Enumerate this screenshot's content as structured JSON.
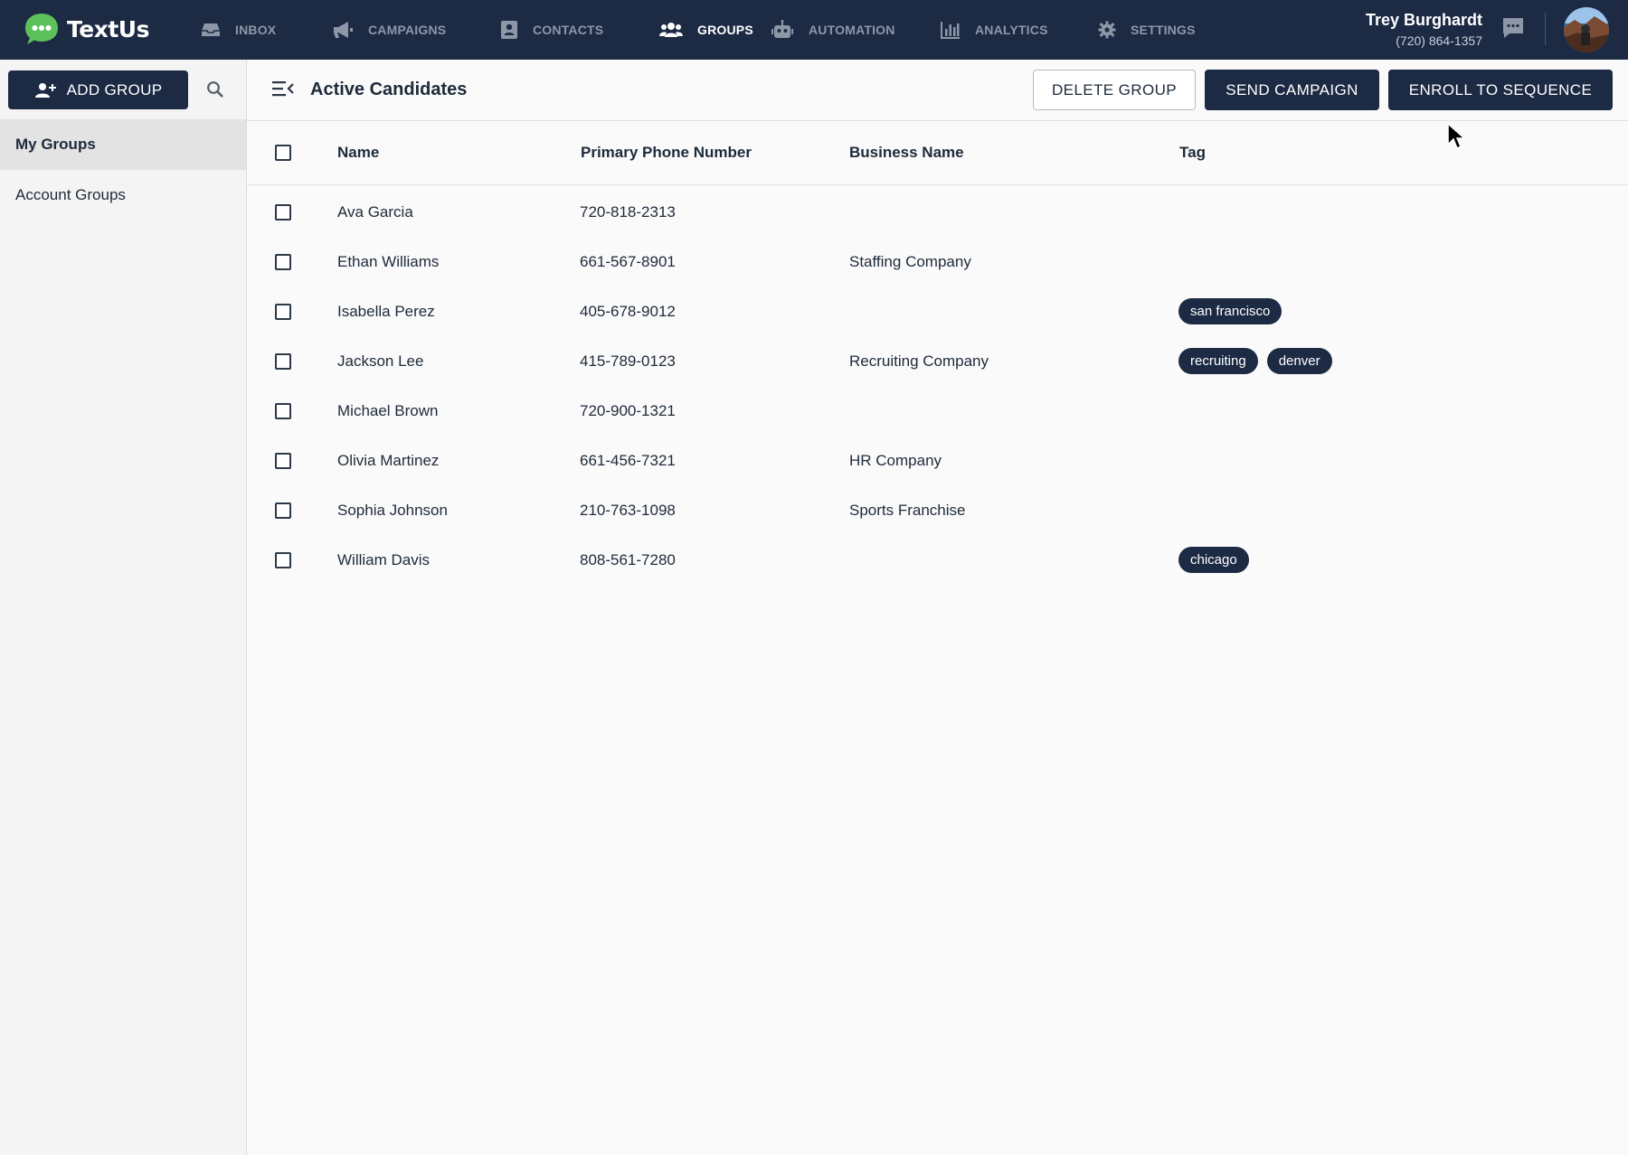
{
  "app": {
    "name": "TextUs"
  },
  "nav": {
    "items": [
      {
        "label": "INBOX",
        "icon": "inbox-icon",
        "active": false
      },
      {
        "label": "CAMPAIGNS",
        "icon": "megaphone-icon",
        "active": false
      },
      {
        "label": "CONTACTS",
        "icon": "contact-book-icon",
        "active": false
      },
      {
        "label": "GROUPS",
        "icon": "users-icon",
        "active": true
      },
      {
        "label": "AUTOMATION",
        "icon": "robot-icon",
        "active": false
      },
      {
        "label": "ANALYTICS",
        "icon": "bar-chart-icon",
        "active": false
      },
      {
        "label": "SETTINGS",
        "icon": "gear-icon",
        "active": false
      }
    ]
  },
  "user": {
    "name": "Trey Burghardt",
    "phone": "(720) 864-1357"
  },
  "sidebar": {
    "add_group_label": "ADD GROUP",
    "items": [
      {
        "label": "My Groups",
        "active": true
      },
      {
        "label": "Account Groups",
        "active": false
      }
    ]
  },
  "header": {
    "title": "Active Candidates",
    "delete_label": "DELETE GROUP",
    "send_label": "SEND CAMPAIGN",
    "enroll_label": "ENROLL TO SEQUENCE"
  },
  "table": {
    "columns": [
      "Name",
      "Primary Phone Number",
      "Business Name",
      "Tag"
    ],
    "rows": [
      {
        "name": "Ava Garcia",
        "phone": "720-818-2313",
        "business": "",
        "tags": []
      },
      {
        "name": "Ethan Williams",
        "phone": "661-567-8901",
        "business": "Staffing Company",
        "tags": []
      },
      {
        "name": "Isabella Perez",
        "phone": "405-678-9012",
        "business": "",
        "tags": [
          "san francisco"
        ]
      },
      {
        "name": "Jackson Lee",
        "phone": "415-789-0123",
        "business": "Recruiting Company",
        "tags": [
          "recruiting",
          "denver"
        ]
      },
      {
        "name": "Michael Brown",
        "phone": "720-900-1321",
        "business": "",
        "tags": []
      },
      {
        "name": "Olivia Martinez",
        "phone": "661-456-7321",
        "business": "HR Company",
        "tags": []
      },
      {
        "name": "Sophia Johnson",
        "phone": "210-763-1098",
        "business": "Sports Franchise",
        "tags": []
      },
      {
        "name": "William Davis",
        "phone": "808-561-7280",
        "business": "",
        "tags": [
          "chicago"
        ]
      }
    ]
  },
  "colors": {
    "nav_bg": "#1c2a44",
    "accent": "#1c2a44",
    "logo_green": "#5cc15a"
  }
}
